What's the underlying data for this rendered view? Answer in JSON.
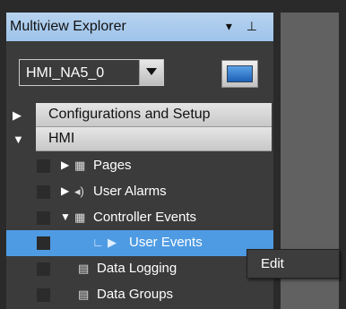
{
  "pane": {
    "title": "Multiview Explorer",
    "title_icons": "▾ ⊥"
  },
  "device_selector": {
    "value": "HMI_NA5_0"
  },
  "sections": {
    "config": "Configurations and Setup",
    "hmi": "HMI"
  },
  "tree": {
    "pages": "Pages",
    "user_alarms": "User Alarms",
    "controller_events": "Controller Events",
    "user_events": "User Events",
    "data_logging": "Data Logging",
    "data_groups": "Data Groups"
  },
  "context_menu": {
    "edit": "Edit"
  },
  "icons": {
    "pages": "grid-page-icon",
    "user_alarms": "speaker-icon",
    "controller_events": "event-grid-icon",
    "user_events": "event-play-icon",
    "data_logging": "logging-icon",
    "data_groups": "data-group-icon"
  },
  "colors": {
    "title_bar": "#a9cbec",
    "selection": "#4f9be3",
    "pane_bg": "#3b3b3b"
  }
}
